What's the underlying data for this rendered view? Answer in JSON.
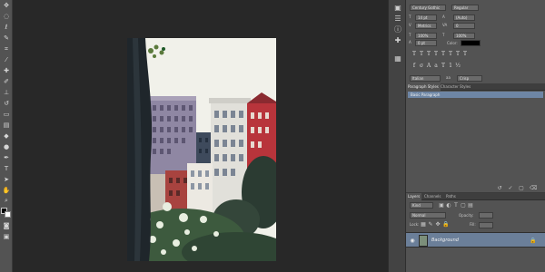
{
  "character": {
    "font_family": "Century Gothic",
    "font_style": "Regular",
    "font_size": "14 pt",
    "leading": "(Auto)",
    "kerning": "Metrics",
    "tracking": "0",
    "vertical_scale": "100%",
    "horizontal_scale": "100%",
    "baseline_shift": "0 pt",
    "color_label": "Color:",
    "language": "Italian",
    "antialias": "Crisp"
  },
  "paragraph_styles": {
    "tabs": [
      "Paragraph Styles",
      "Character Styles"
    ],
    "items": [
      "Basic Paragraph"
    ]
  },
  "layers": {
    "tabs": [
      "Layers",
      "Channels",
      "Paths"
    ],
    "kind_filter": "Kind",
    "blend_mode": "Normal",
    "opacity_label": "Opacity:",
    "fill_label": "Fill:",
    "lock_label": "Lock:",
    "items": [
      {
        "name": "Background"
      }
    ]
  },
  "colors": {
    "app_bg": "#282828",
    "panel_bg": "#535353",
    "selection": "#6e86a5",
    "sky": "#f1f1ea",
    "brick": "#b8343b"
  }
}
